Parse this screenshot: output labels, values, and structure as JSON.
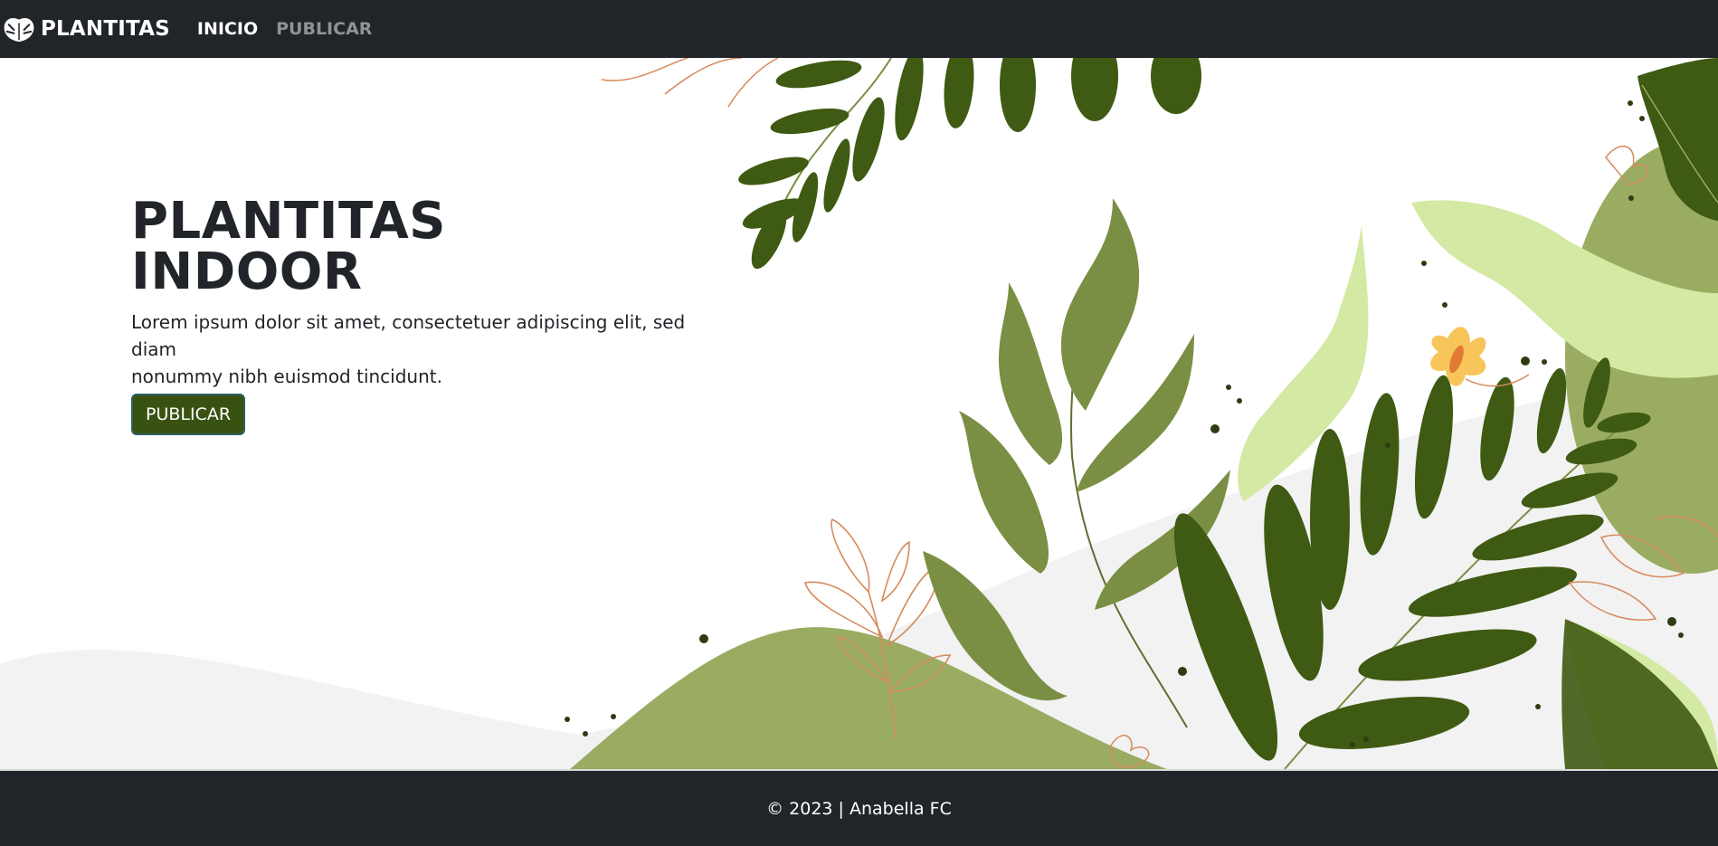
{
  "navbar": {
    "brand_icon": "monstera-leaf-icon",
    "brand": "PLANTITAS",
    "links": [
      {
        "label": "INICIO",
        "state": "active"
      },
      {
        "label": "PUBLICAR",
        "state": "inactive"
      }
    ]
  },
  "hero": {
    "title_line1": "PLANTITAS",
    "title_line2": "INDOOR",
    "description_line1": "Lorem ipsum dolor sit amet, consectetuer adipiscing elit, sed diam",
    "description_line2": "nonummy nibh euismod tincidunt.",
    "button_label": "PUBLICAR"
  },
  "footer": {
    "text": "© 2023 | Anabella FC"
  },
  "colors": {
    "navbar_bg": "#212529",
    "button_bg": "#3a5211",
    "leaf_dark": "#3f5a12",
    "leaf_mid": "#7a8f43",
    "leaf_light": "#d4e9a3",
    "hill": "#9aac62",
    "flower": "#f7c55a"
  }
}
